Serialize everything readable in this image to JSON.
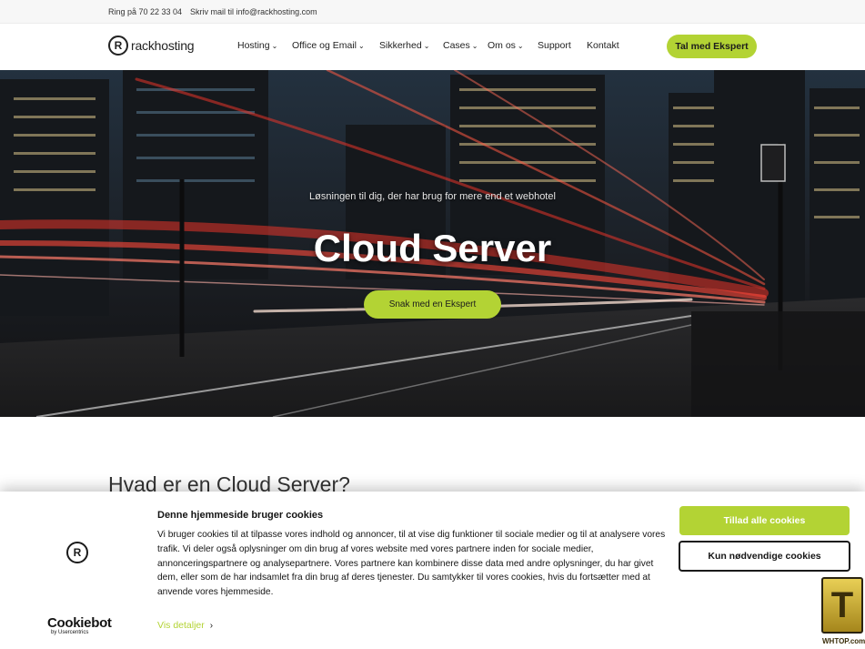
{
  "topbar": {
    "phone": "Ring på 70 22 33 04",
    "mail": "Skriv mail til info@rackhosting.com"
  },
  "header": {
    "logo_text": "rackhosting",
    "nav": [
      {
        "label": "Hosting",
        "dropdown": true
      },
      {
        "label": "Office og Email",
        "dropdown": true
      },
      {
        "label": "Sikkerhed",
        "dropdown": true
      },
      {
        "label": "Cases",
        "dropdown": true
      },
      {
        "label": "Om os",
        "dropdown": true
      },
      {
        "label": "Support",
        "dropdown": false
      },
      {
        "label": "Kontakt",
        "dropdown": false
      }
    ],
    "cta": "Tal med Ekspert"
  },
  "hero": {
    "subtitle": "Løsningen til dig, der har brug for mere end et webhotel",
    "title": "Cloud Server",
    "button": "Snak med en Ekspert"
  },
  "content": {
    "heading": "Hvad er en Cloud Server?"
  },
  "cookie_banner": {
    "title": "Denne hjemmeside bruger cookies",
    "text": "Vi bruger cookies til at tilpasse vores indhold og annoncer, til at vise dig funktioner til sociale medier og til at analysere vores trafik. Vi deler også oplysninger om din brug af vores website med vores partnere inden for sociale medier, annonceringspartnere og analysepartnere. Vores partnere kan kombinere disse data med andre oplysninger, du har givet dem, eller som de har indsamlet fra din brug af deres tjenester. Du samtykker til vores cookies, hvis du fortsætter med at anvende vores hjemmeside.",
    "details_link": "Vis detaljer",
    "allow_all": "Tillad alle cookies",
    "necessary_only": "Kun nødvendige cookies",
    "brand": "Cookiebot",
    "brand_by": "by Usercentrics"
  },
  "watermark": {
    "letter": "T",
    "text": "WHTOP.com"
  },
  "colors": {
    "accent": "#b3d334",
    "text": "#222222",
    "topbar_bg": "#f7f7f7"
  },
  "icons": {
    "logo": "rackhosting-r-circle-icon",
    "dropdown": "chevron-down-icon",
    "details": "chevron-right-icon"
  }
}
